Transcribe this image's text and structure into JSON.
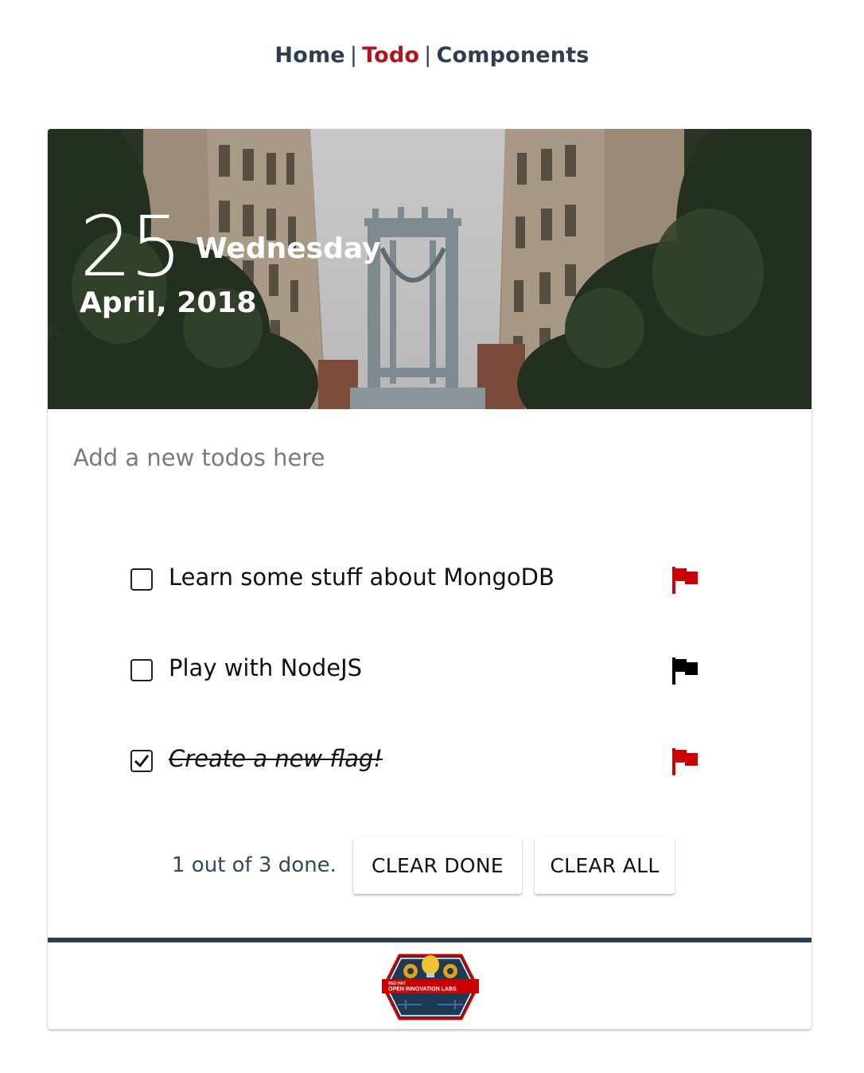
{
  "nav": {
    "items": [
      {
        "label": "Home",
        "active": false
      },
      {
        "label": "Todo",
        "active": true
      },
      {
        "label": "Components",
        "active": false
      }
    ],
    "separator": "|",
    "text_color": "#2c3e50",
    "active_color": "#b2131c"
  },
  "header": {
    "day": "25",
    "weekday": "Wednesday",
    "month_year": "April, 2018"
  },
  "new_todo": {
    "placeholder": "Add a new todos here",
    "value": ""
  },
  "todos": [
    {
      "title": "Learn some stuff about MongoDB",
      "completed": false,
      "important": true,
      "flag_color": "#cc0000"
    },
    {
      "title": "Play with NodeJS",
      "completed": false,
      "important": false,
      "flag_color": "#000000"
    },
    {
      "title": "Create a new flag!",
      "completed": true,
      "important": true,
      "flag_color": "#cc0000"
    }
  ],
  "footer": {
    "status": "1 out of 3 done.",
    "clear_done_label": "CLEAR DONE",
    "clear_all_label": "CLEAR ALL",
    "logo_text_top": "RED HAT",
    "logo_text_bottom": "OPEN INNOVATION LABS"
  }
}
